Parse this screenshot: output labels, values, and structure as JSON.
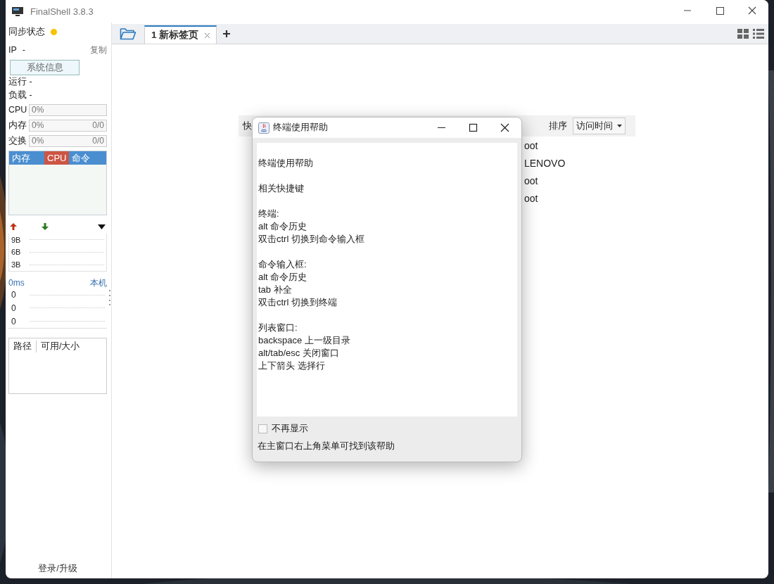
{
  "window": {
    "title": "FinalShell 3.8.3"
  },
  "sidebar": {
    "sync_label": "同步状态",
    "ip_label": "IP",
    "ip_value": "-",
    "copy_link": "复制",
    "sysinfo_button": "系统信息",
    "stats": [
      "运行 -",
      "负载 -"
    ],
    "meters": [
      {
        "label": "CPU",
        "percent": "0%",
        "level": 0
      },
      {
        "label": "内存",
        "percent": "0%",
        "amount": "0/0",
        "level": 0
      },
      {
        "label": "交换",
        "percent": "0%",
        "amount": "0/0",
        "level": 0
      }
    ],
    "process_tabs": [
      {
        "label": "内存",
        "selected": false
      },
      {
        "label": "CPU",
        "selected": true
      },
      {
        "label": "命令",
        "selected": false
      }
    ],
    "network": {
      "yticks": [
        "9B",
        "6B",
        "3B"
      ]
    },
    "latency": {
      "value": "0ms",
      "host": "本机",
      "yticks": [
        "0",
        "0",
        "0"
      ]
    },
    "disk_table": {
      "columns": [
        "路径",
        "可用/大小"
      ]
    },
    "login_link": "登录/升级"
  },
  "tabs": [
    {
      "label": "1 新标签页",
      "selected": true
    }
  ],
  "connections": {
    "title": "快",
    "sort_label": "排序",
    "sort_value": "访问时间",
    "rows": [
      "oot",
      "LENOVO",
      "oot",
      "oot"
    ]
  },
  "dialog": {
    "title": "终端使用帮助",
    "groups": [
      [
        "终端使用帮助"
      ],
      [
        "相关快捷键"
      ],
      [
        "终端:",
        "alt 命令历史",
        "双击ctrl 切换到命令输入框"
      ],
      [
        "命令输入框:",
        "alt 命令历史",
        "tab 补全",
        "双击ctrl 切换到终端"
      ],
      [
        "列表窗口:",
        "backspace 上一级目录",
        "alt/tab/esc 关闭窗口",
        "上下箭头 选择行"
      ]
    ],
    "checkbox": {
      "label": "不再显示",
      "checked": false
    },
    "note": "在主窗口右上角菜单可找到该帮助"
  }
}
